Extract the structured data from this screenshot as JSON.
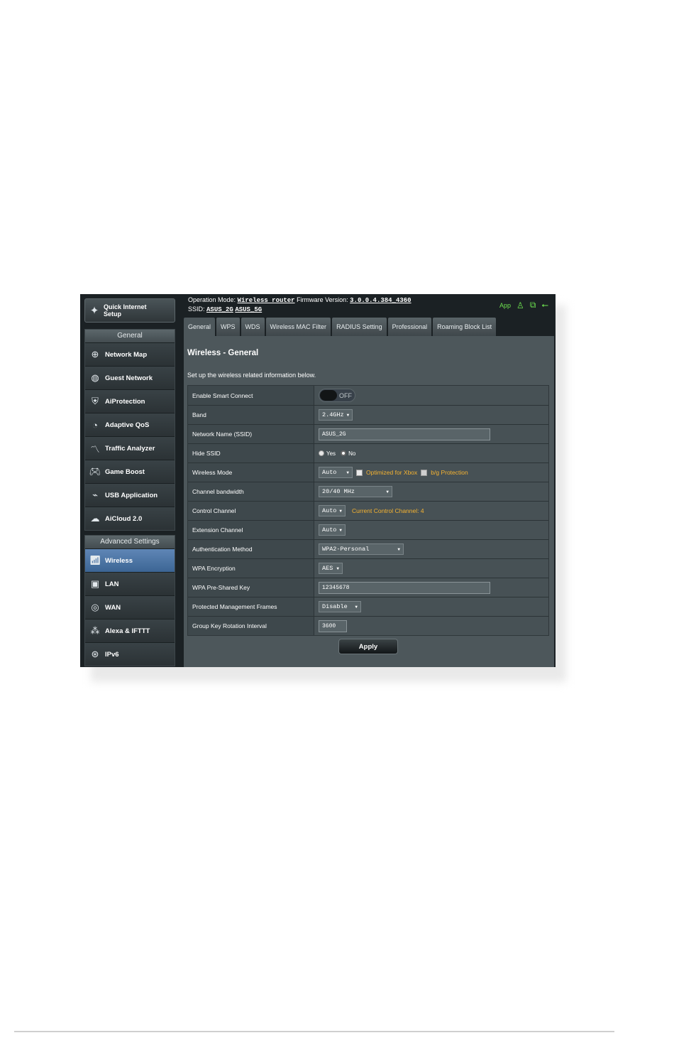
{
  "sidebar": {
    "quick_setup": {
      "label": "Quick Internet Setup",
      "icon": "wand-icon"
    },
    "general_header": "General",
    "general_items": [
      {
        "label": "Network Map",
        "icon": "network-map-icon"
      },
      {
        "label": "Guest Network",
        "icon": "globe-icon"
      },
      {
        "label": "AiProtection",
        "icon": "lock-icon"
      },
      {
        "label": "Adaptive QoS",
        "icon": "gauge-icon"
      },
      {
        "label": "Traffic Analyzer",
        "icon": "pulse-icon"
      },
      {
        "label": "Game Boost",
        "icon": "gamepad-icon"
      },
      {
        "label": "USB Application",
        "icon": "usb-icon"
      },
      {
        "label": "AiCloud 2.0",
        "icon": "cloud-icon"
      }
    ],
    "advanced_header": "Advanced Settings",
    "advanced_items": [
      {
        "label": "Wireless",
        "icon": "wireless-icon",
        "active": true
      },
      {
        "label": "LAN",
        "icon": "lan-icon"
      },
      {
        "label": "WAN",
        "icon": "wan-icon"
      },
      {
        "label": "Alexa & IFTTT",
        "icon": "alexa-icon"
      },
      {
        "label": "IPv6",
        "icon": "ipv6-icon"
      }
    ]
  },
  "header": {
    "op_mode_label": "Operation Mode:",
    "op_mode_value": "Wireless router",
    "firmware_label": "Firmware Version:",
    "firmware_value": "3.0.0.4.384_4360",
    "ssid_label": "SSID:",
    "ssid_2g": "ASUS_2G",
    "ssid_5g": "ASUS_5G",
    "app_label": "App"
  },
  "tabs": [
    "General",
    "WPS",
    "WDS",
    "Wireless MAC Filter",
    "RADIUS Setting",
    "Professional",
    "Roaming Block List"
  ],
  "page": {
    "title": "Wireless - General",
    "description": "Set up the wireless related information below."
  },
  "form": {
    "smart_connect": {
      "label": "Enable Smart Connect",
      "value": "OFF"
    },
    "band": {
      "label": "Band",
      "value": "2.4GHz"
    },
    "ssid": {
      "label": "Network Name (SSID)",
      "value": "ASUS_2G"
    },
    "hide_ssid": {
      "label": "Hide SSID",
      "yes": "Yes",
      "no": "No",
      "selected": "No"
    },
    "wireless_mode": {
      "label": "Wireless Mode",
      "value": "Auto",
      "xbox": "Optimized for Xbox",
      "bg": "b/g Protection"
    },
    "channel_bw": {
      "label": "Channel bandwidth",
      "value": "20/40 MHz"
    },
    "control_channel": {
      "label": "Control Channel",
      "value": "Auto",
      "current": "Current Control Channel: 4"
    },
    "extension_channel": {
      "label": "Extension Channel",
      "value": "Auto"
    },
    "auth_method": {
      "label": "Authentication Method",
      "value": "WPA2-Personal"
    },
    "wpa_encryption": {
      "label": "WPA Encryption",
      "value": "AES"
    },
    "wpa_key": {
      "label": "WPA Pre-Shared Key",
      "value": "12345678"
    },
    "pmf": {
      "label": "Protected Management Frames",
      "value": "Disable"
    },
    "gkri": {
      "label": "Group Key Rotation Interval",
      "value": "3600"
    }
  },
  "apply_label": "Apply",
  "colors": {
    "accent_green": "#6de24f",
    "note_orange": "#f5b331",
    "active_blue": "#4a74a6"
  }
}
